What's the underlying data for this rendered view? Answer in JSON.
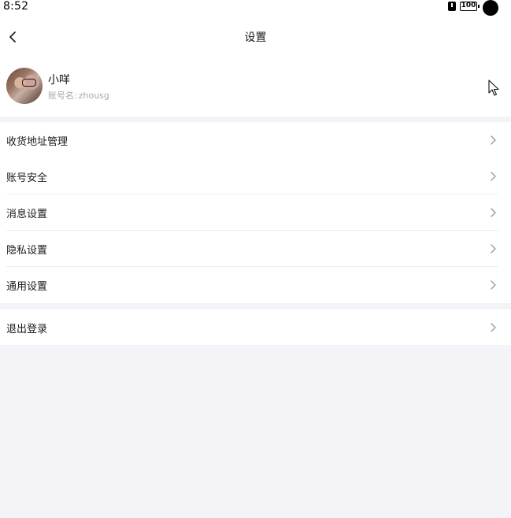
{
  "status_bar": {
    "time": "8:52",
    "battery": "100"
  },
  "nav": {
    "title": "设置"
  },
  "profile": {
    "name": "小咩",
    "account_label": "账号名:",
    "account_value": "zhousg"
  },
  "menu": {
    "group1": [
      {
        "label": "收货地址管理"
      },
      {
        "label": "账号安全"
      },
      {
        "label": "消息设置"
      },
      {
        "label": "隐私设置"
      },
      {
        "label": "通用设置"
      }
    ],
    "group2": [
      {
        "label": "退出登录"
      }
    ]
  }
}
